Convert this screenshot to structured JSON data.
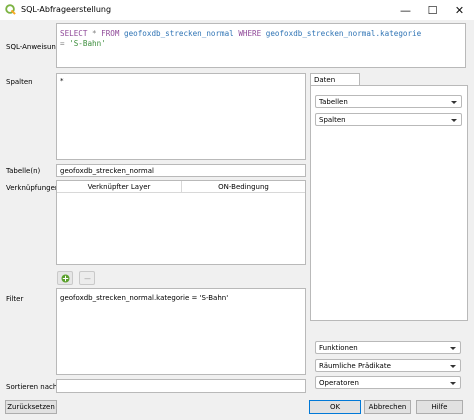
{
  "window": {
    "title": "SQL-Abfrageerstellung",
    "minimize_icon": "minimize-icon",
    "maximize_icon": "maximize-icon",
    "close_icon": "close-icon"
  },
  "sql": {
    "label": "SQL-Anweisung",
    "line1": {
      "kw1": "SELECT",
      "rest1": " * ",
      "kw2": "FROM",
      "table": " geofoxdb_strecken_normal ",
      "kw3": "WHERE",
      "column": " geofoxdb_strecken_normal.kategorie"
    },
    "line2": {
      "op": "= ",
      "value": "'S-Bahn'"
    }
  },
  "spalten": {
    "label": "Spalten",
    "value": "*"
  },
  "daten": {
    "tab_label": "Daten",
    "tabellen_label": "Tabellen",
    "spalten_label": "Spalten"
  },
  "tabellen": {
    "label": "Tabelle(n)",
    "value": "geofoxdb_strecken_normal"
  },
  "verknuepfungen": {
    "label": "Verknüpfungen",
    "columns": [
      "Verknüpfter Layer",
      "ON-Bedingung"
    ]
  },
  "join_buttons": {
    "add_icon": "add-join-icon",
    "remove_icon": "remove-join-icon"
  },
  "filter": {
    "label": "Filter",
    "value": "geofoxdb_strecken_normal.kategorie = 'S-Bahn'"
  },
  "funktionen": {
    "funktionen_label": "Funktionen",
    "praedikate_label": "Räumliche Prädikate",
    "operatoren_label": "Operatoren"
  },
  "sortieren": {
    "label": "Sortieren nach",
    "value": ""
  },
  "buttons": {
    "reset": "Zurücksetzen",
    "ok": "OK",
    "cancel": "Abbrechen",
    "help": "Hilfe"
  }
}
